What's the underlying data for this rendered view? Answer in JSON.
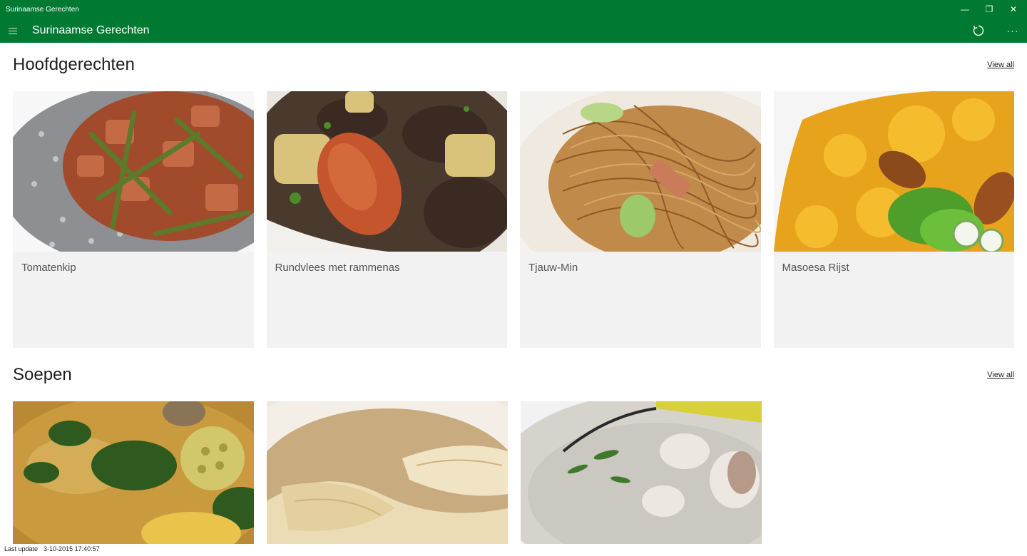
{
  "window": {
    "title": "Surinaamse Gerechten",
    "controls": {
      "minimize": "—",
      "restore": "❐",
      "close": "✕"
    }
  },
  "appbar": {
    "title": "Surinaamse Gerechten",
    "menu_icon": "hamburger-icon",
    "refresh_icon": "refresh-icon",
    "more_label": "···"
  },
  "sections": [
    {
      "title": "Hoofdgerechten",
      "view_all": "View all",
      "items": [
        {
          "label": "Tomatenkip",
          "image": "chicken-green-beans"
        },
        {
          "label": "Rundvlees met rammenas",
          "image": "beef-stew"
        },
        {
          "label": "Tjauw-Min",
          "image": "fried-noodles"
        },
        {
          "label": "Masoesa Rijst",
          "image": "yellow-rice"
        }
      ]
    },
    {
      "title": "Soepen",
      "view_all": "View all",
      "items": [
        {
          "label": "",
          "image": "okra-soup"
        },
        {
          "label": "",
          "image": "wonton-soup"
        },
        {
          "label": "",
          "image": "fish-soup"
        }
      ]
    }
  ],
  "footer": {
    "label": "Last update",
    "value": "3-10-2015 17:40:57"
  },
  "colors": {
    "accent": "#007a33",
    "card_bg": "#f2f2f2",
    "text_muted": "#555555"
  }
}
